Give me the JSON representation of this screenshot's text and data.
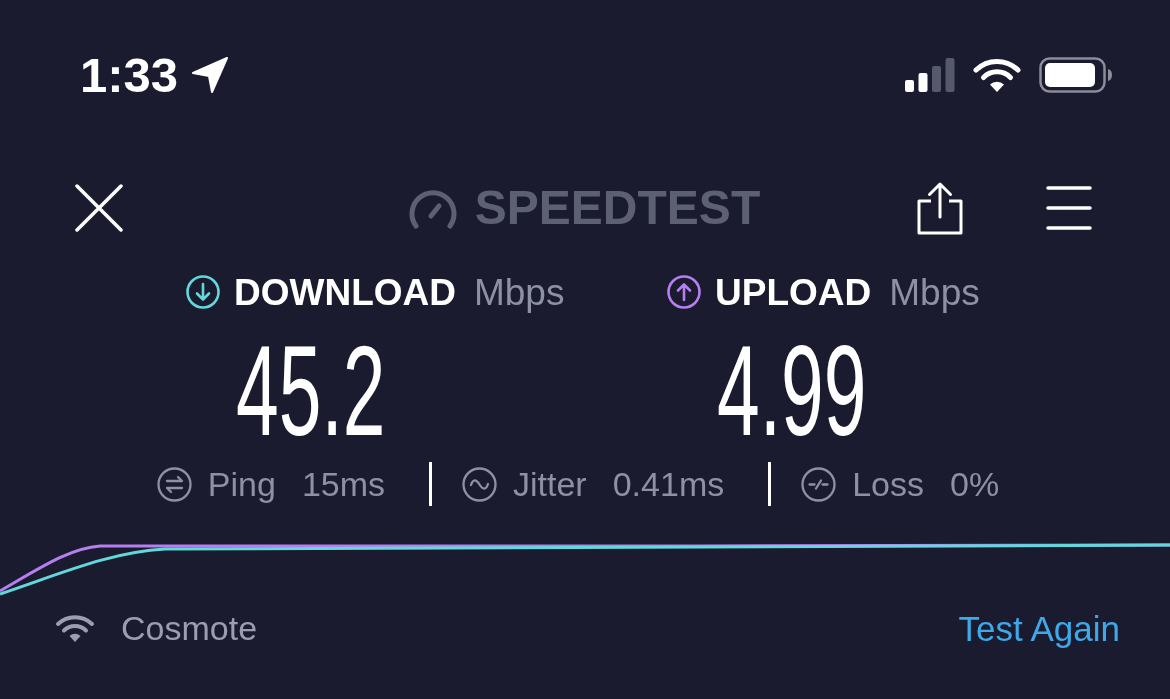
{
  "status_bar": {
    "time": "1:33"
  },
  "header": {
    "logo": "SPEEDTEST"
  },
  "metrics": [
    {
      "kind": "download",
      "label": "DOWNLOAD",
      "unit": "Mbps",
      "value": "45.2",
      "color": "#62d8dc"
    },
    {
      "kind": "upload",
      "label": "UPLOAD",
      "unit": "Mbps",
      "value": "4.99",
      "color": "#b67ff0"
    }
  ],
  "stats": [
    {
      "kind": "ping",
      "label": "Ping",
      "value": "15ms"
    },
    {
      "kind": "jitter",
      "label": "Jitter",
      "value": "0.41ms"
    },
    {
      "kind": "loss",
      "label": "Loss",
      "value": "0%"
    }
  ],
  "footer": {
    "network": "Cosmote",
    "action": "Test Again"
  }
}
